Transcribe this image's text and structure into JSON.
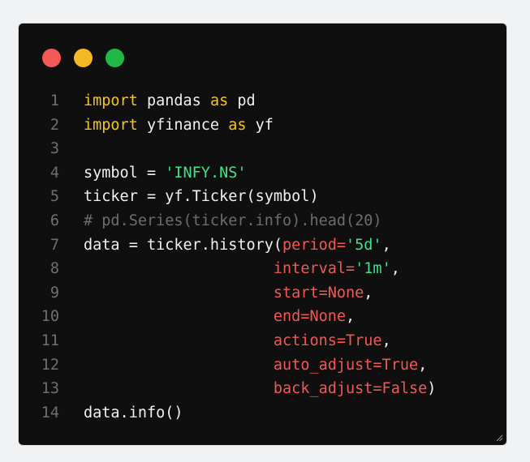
{
  "window": {
    "traffic_lights": {
      "colors": {
        "close": "#f25a55",
        "minimize": "#f4b823",
        "maximize": "#21b845"
      }
    }
  },
  "colors": {
    "background": "#0f0f10",
    "text": "#f1f1f1",
    "keyword": "#f5c518",
    "string": "#3fe08a",
    "comment": "#6c6d71",
    "kwarg": "#f15854",
    "line_number": "#6e6f73"
  },
  "code": {
    "lines": [
      {
        "n": "1",
        "tokens": [
          {
            "t": "import",
            "c": "kw"
          },
          {
            "t": " pandas "
          },
          {
            "t": "as",
            "c": "kw"
          },
          {
            "t": " pd"
          }
        ]
      },
      {
        "n": "2",
        "tokens": [
          {
            "t": "import",
            "c": "kw"
          },
          {
            "t": " yfinance "
          },
          {
            "t": "as",
            "c": "kw"
          },
          {
            "t": " yf"
          }
        ]
      },
      {
        "n": "3",
        "tokens": []
      },
      {
        "n": "4",
        "tokens": [
          {
            "t": "symbol = "
          },
          {
            "t": "'INFY.NS'",
            "c": "str"
          }
        ]
      },
      {
        "n": "5",
        "tokens": [
          {
            "t": "ticker = yf.Ticker(symbol)"
          }
        ]
      },
      {
        "n": "6",
        "tokens": [
          {
            "t": "# pd.Series(ticker.info).head(20)",
            "c": "cm"
          }
        ]
      },
      {
        "n": "7",
        "tokens": [
          {
            "t": "data = ticker.history("
          },
          {
            "t": "period=",
            "c": "kwarg"
          },
          {
            "t": "'5d'",
            "c": "str"
          },
          {
            "t": ","
          }
        ]
      },
      {
        "n": "8",
        "tokens": [
          {
            "t": "                     "
          },
          {
            "t": "interval=",
            "c": "kwarg"
          },
          {
            "t": "'1m'",
            "c": "str"
          },
          {
            "t": ","
          }
        ]
      },
      {
        "n": "9",
        "tokens": [
          {
            "t": "                     "
          },
          {
            "t": "start=None",
            "c": "kwarg"
          },
          {
            "t": ","
          }
        ]
      },
      {
        "n": "10",
        "tokens": [
          {
            "t": "                     "
          },
          {
            "t": "end=None",
            "c": "kwarg"
          },
          {
            "t": ","
          }
        ]
      },
      {
        "n": "11",
        "tokens": [
          {
            "t": "                     "
          },
          {
            "t": "actions=True",
            "c": "kwarg"
          },
          {
            "t": ","
          }
        ]
      },
      {
        "n": "12",
        "tokens": [
          {
            "t": "                     "
          },
          {
            "t": "auto_adjust=True",
            "c": "kwarg"
          },
          {
            "t": ","
          }
        ]
      },
      {
        "n": "13",
        "tokens": [
          {
            "t": "                     "
          },
          {
            "t": "back_adjust=False",
            "c": "kwarg"
          },
          {
            "t": ")"
          }
        ]
      },
      {
        "n": "14",
        "tokens": [
          {
            "t": "data.info()"
          }
        ]
      }
    ]
  }
}
